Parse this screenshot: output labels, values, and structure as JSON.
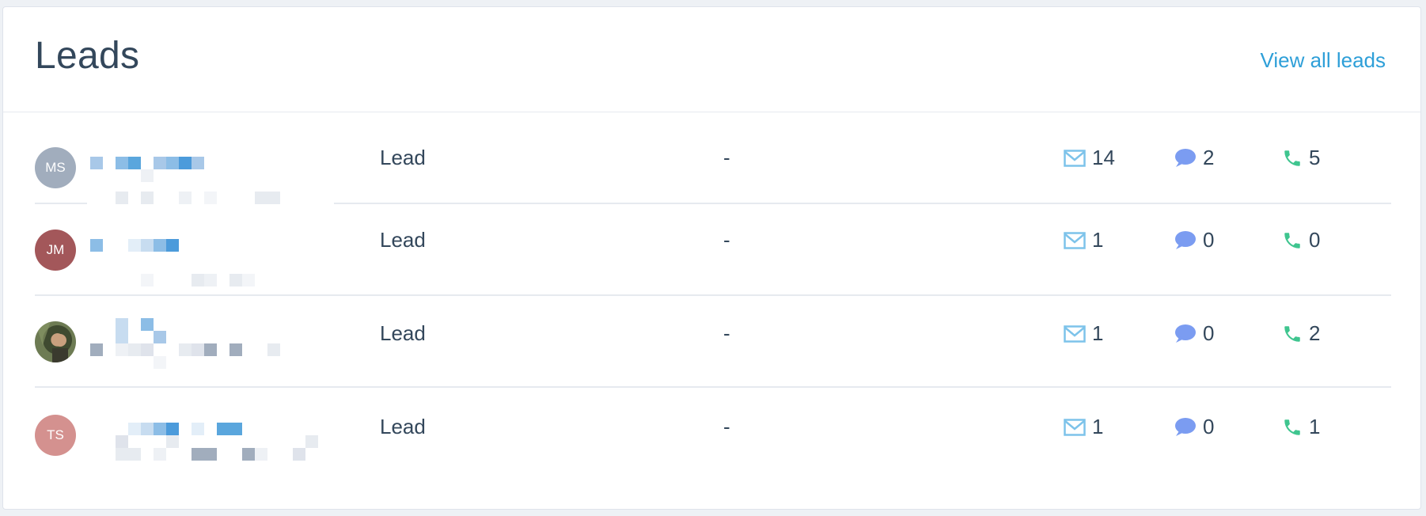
{
  "card": {
    "title": "Leads",
    "view_all_label": "View all leads"
  },
  "colors": {
    "accent_link": "#2e9fd8",
    "email_icon": "#7dc3ea",
    "chat_icon": "#7b9cf1",
    "call_icon": "#3fc58f"
  },
  "leads": [
    {
      "initials": "MS",
      "avatar_color": "#a1adbd",
      "status": "Lead",
      "detail": "-",
      "emails": "14",
      "messages": "2",
      "calls": "5"
    },
    {
      "initials": "JM",
      "avatar_color": "#a3575a",
      "status": "Lead",
      "detail": "-",
      "emails": "1",
      "messages": "0",
      "calls": "0"
    },
    {
      "initials": "",
      "avatar_color": "#4d5a38",
      "status": "Lead",
      "detail": "-",
      "emails": "1",
      "messages": "0",
      "calls": "2"
    },
    {
      "initials": "TS",
      "avatar_color": "#d4918f",
      "status": "Lead",
      "detail": "-",
      "emails": "1",
      "messages": "0",
      "calls": "1"
    }
  ]
}
